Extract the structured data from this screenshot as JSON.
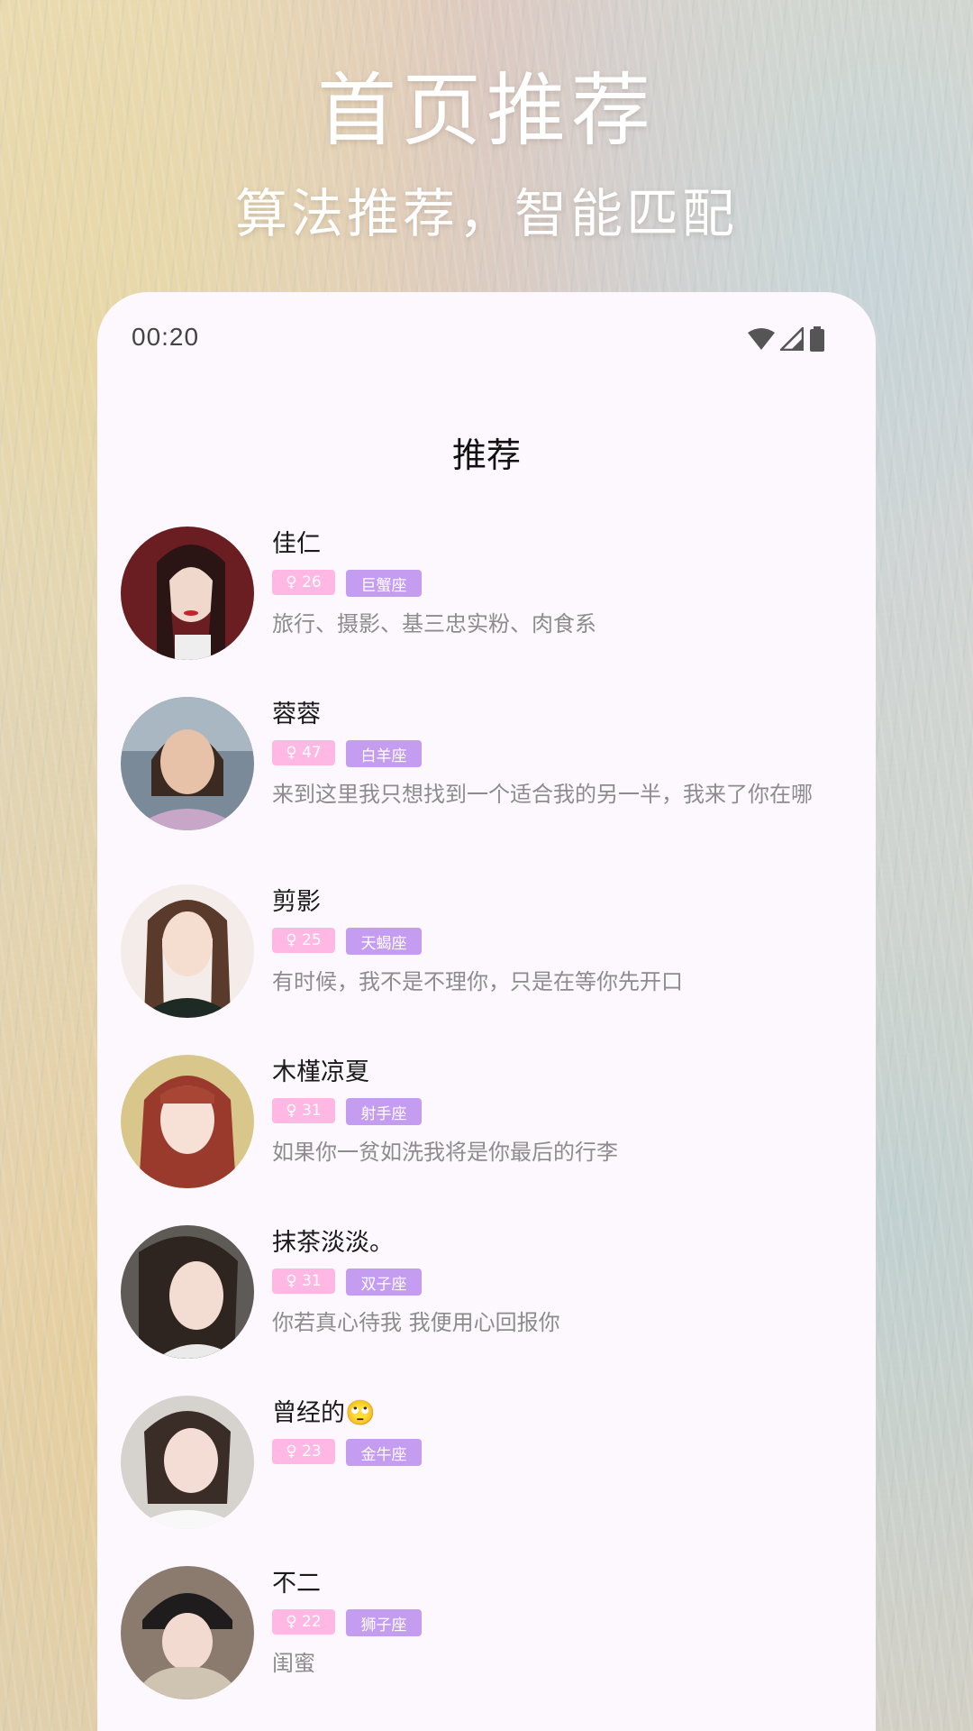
{
  "header": {
    "title": "首页推荐",
    "subtitle": "算法推荐，智能匹配"
  },
  "status_bar": {
    "time": "00:20",
    "icons": [
      "wifi-icon",
      "signal-icon",
      "battery-icon"
    ]
  },
  "page": {
    "title": "推荐"
  },
  "colors": {
    "age_tag": "#ffb8e4",
    "zodiac_tag": "#c49cf0",
    "card_background": "#fdf8fd"
  },
  "users": [
    {
      "name": "佳仁",
      "age": "♀ 26",
      "zodiac": "巨蟹座",
      "bio": "旅行、摄影、基三忠实粉、肉食系"
    },
    {
      "name": "蓉蓉",
      "age": "♀ 47",
      "zodiac": "白羊座",
      "bio": "来到这里我只想找到一个适合我的另一半，我来了你在哪"
    },
    {
      "name": "剪影",
      "age": "♀ 25",
      "zodiac": "天蝎座",
      "bio": "有时候，我不是不理你，只是在等你先开口"
    },
    {
      "name": "木槿凉夏",
      "age": "♀ 31",
      "zodiac": "射手座",
      "bio": "如果你一贫如洗我将是你最后的行李"
    },
    {
      "name": "抹茶淡淡。",
      "age": "♀ 31",
      "zodiac": "双子座",
      "bio": "你若真心待我 我便用心回报你"
    },
    {
      "name": "曾经的🙄",
      "age": "♀ 23",
      "zodiac": "金牛座",
      "bio": ""
    },
    {
      "name": "不二",
      "age": "♀ 22",
      "zodiac": "狮子座",
      "bio": "闺蜜"
    }
  ]
}
